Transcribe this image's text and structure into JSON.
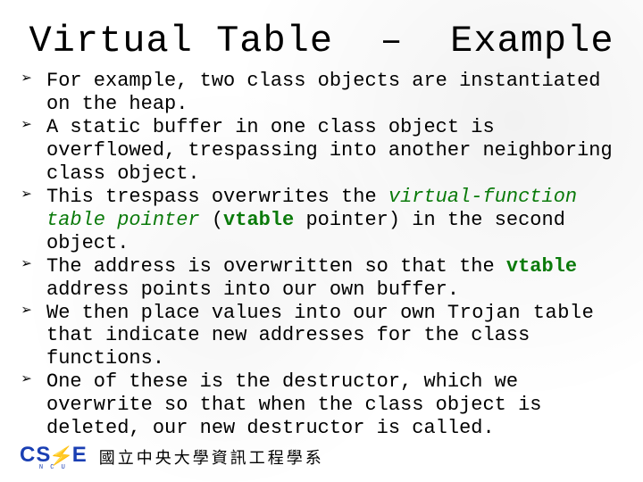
{
  "title": "Virtual Table  –  Example",
  "bullet_marker": "➢",
  "bullets": [
    {
      "segments": [
        {
          "kind": "plain",
          "text": "For example, two class objects are instantiated on the heap."
        }
      ]
    },
    {
      "segments": [
        {
          "kind": "plain",
          "text": "A static buffer in one class object is overflowed, trespassing into another neighboring class object."
        }
      ]
    },
    {
      "segments": [
        {
          "kind": "plain",
          "text": "This trespass overwrites the "
        },
        {
          "kind": "italic-green",
          "text": "virtual-function table pointer"
        },
        {
          "kind": "plain",
          "text": " ("
        },
        {
          "kind": "bold-green",
          "text": "vtable"
        },
        {
          "kind": "plain",
          "text": " pointer) in the second object."
        }
      ]
    },
    {
      "segments": [
        {
          "kind": "plain",
          "text": "The address is overwritten so that the "
        },
        {
          "kind": "bold-green",
          "text": "vtable"
        },
        {
          "kind": "plain",
          "text": " address points into our own buffer."
        }
      ]
    },
    {
      "segments": [
        {
          "kind": "plain",
          "text": "We then place values into our own "
        },
        {
          "kind": "trojan",
          "text": "Trojan table"
        },
        {
          "kind": "plain",
          "text": " that indicate new addresses for the class functions."
        }
      ]
    },
    {
      "segments": [
        {
          "kind": "plain",
          "text": "One of these is the destructor, which we overwrite so that when the class object is deleted, our new destructor is called."
        }
      ]
    }
  ],
  "footer": {
    "logo_cs": "CS",
    "logo_e": "E",
    "logo_sub": "N C U",
    "text": "國立中央大學資訊工程學系"
  },
  "colors": {
    "accent_green": "#0a7a0a",
    "logo_blue": "#1a3fb3",
    "logo_bolt": "#f5a623"
  }
}
